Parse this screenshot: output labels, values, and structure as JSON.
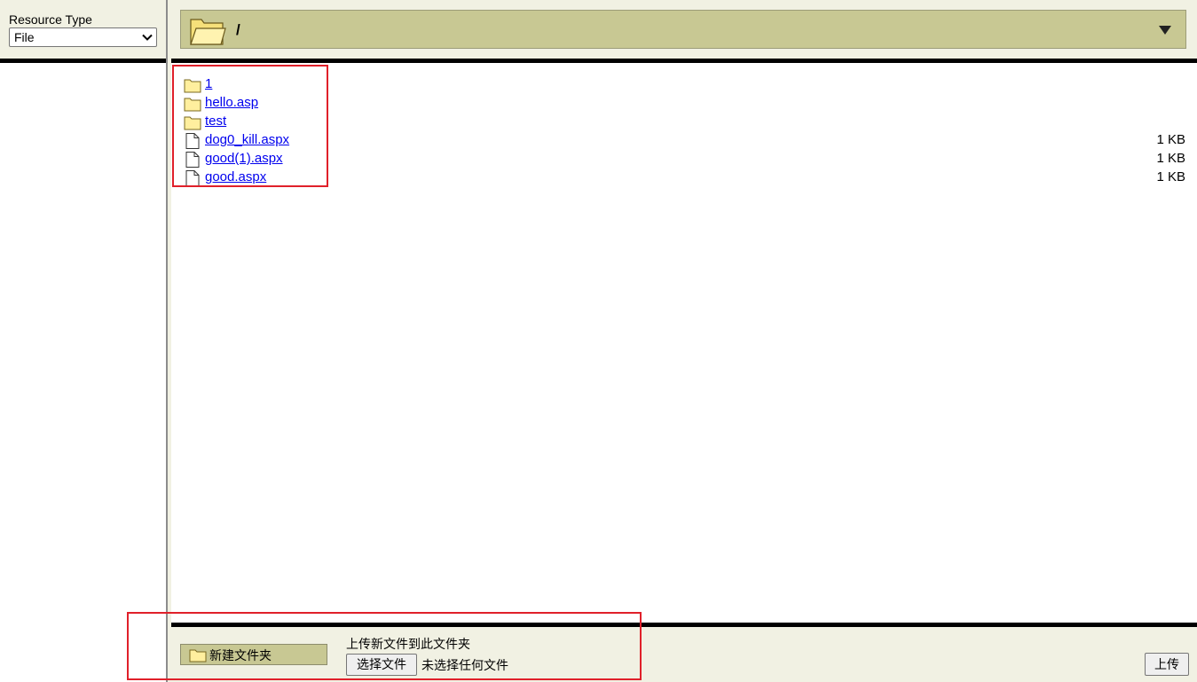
{
  "resource_type": {
    "label": "Resource Type",
    "selected": "File"
  },
  "path_bar": {
    "path": "/",
    "folder_icon": "open-folder-icon",
    "dropdown_icon": "triangle-down-icon"
  },
  "files": [
    {
      "name": "1",
      "type": "folder",
      "size": "",
      "icon": "folder-icon"
    },
    {
      "name": "hello.asp",
      "type": "folder",
      "size": "",
      "icon": "folder-icon"
    },
    {
      "name": "test",
      "type": "folder",
      "size": "",
      "icon": "folder-icon"
    },
    {
      "name": "dog0_kill.aspx",
      "type": "file",
      "size": "1 KB",
      "icon": "file-icon"
    },
    {
      "name": "good(1).aspx",
      "type": "file",
      "size": "1 KB",
      "icon": "file-icon"
    },
    {
      "name": "good.aspx",
      "type": "file",
      "size": "1 KB",
      "icon": "file-icon"
    }
  ],
  "bottom": {
    "new_folder_label": "新建文件夹",
    "upload_title": "上传新文件到此文件夹",
    "choose_file_label": "选择文件",
    "no_file_text": "未选择任何文件",
    "upload_label": "上传"
  },
  "colors": {
    "toolbar_bg": "#f1f1e3",
    "path_bar_bg": "#c8c893",
    "link": "#0000ee",
    "highlight_box": "#e0202a",
    "folder_fill": "#ffef9e"
  }
}
